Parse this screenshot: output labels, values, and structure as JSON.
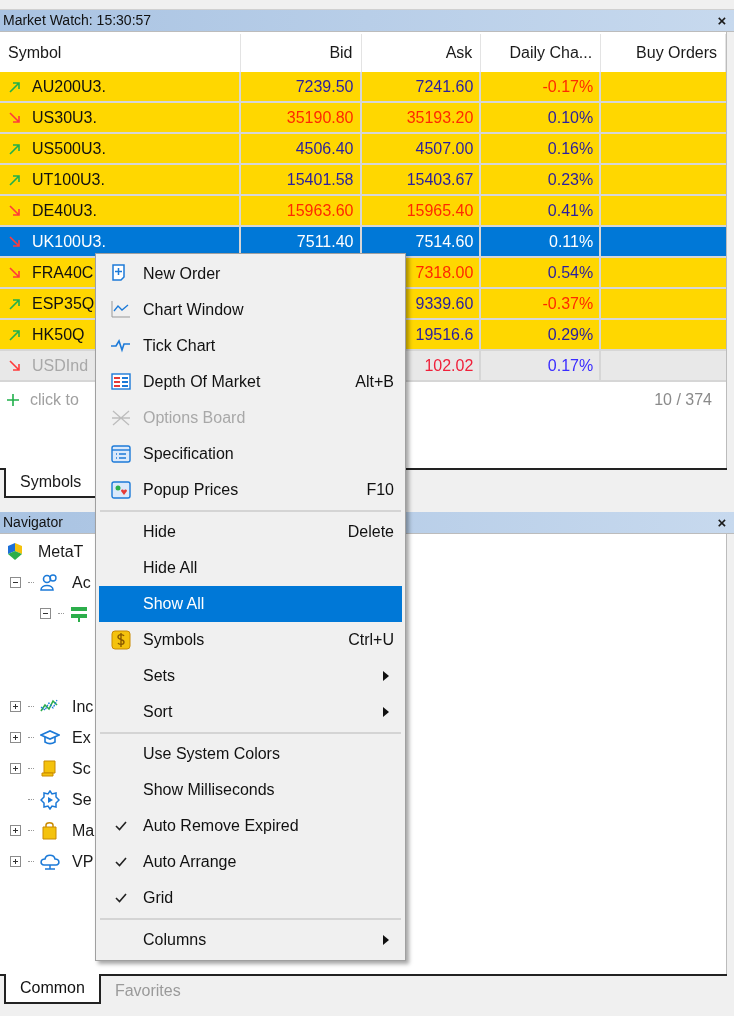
{
  "market_watch": {
    "title": "Market Watch: 15:30:57",
    "close": "×",
    "columns": [
      "Symbol",
      "Bid",
      "Ask",
      "Daily Cha...",
      "Buy Orders"
    ],
    "rows": [
      {
        "symbol": "AU200U3.",
        "trend_up": true,
        "bid": "7239.50",
        "bid_up": true,
        "ask": "7241.60",
        "ask_up": true,
        "change": "-0.17%",
        "change_up": false,
        "selected": false,
        "disabled": false
      },
      {
        "symbol": "US30U3.",
        "trend_up": false,
        "bid": "35190.80",
        "bid_up": false,
        "ask": "35193.20",
        "ask_up": false,
        "change": "0.10%",
        "change_up": true,
        "selected": false,
        "disabled": false
      },
      {
        "symbol": "US500U3.",
        "trend_up": true,
        "bid": "4506.40",
        "bid_up": true,
        "ask": "4507.00",
        "ask_up": true,
        "change": "0.16%",
        "change_up": true,
        "selected": false,
        "disabled": false
      },
      {
        "symbol": "UT100U3.",
        "trend_up": true,
        "bid": "15401.58",
        "bid_up": true,
        "ask": "15403.67",
        "ask_up": true,
        "change": "0.23%",
        "change_up": true,
        "selected": false,
        "disabled": false
      },
      {
        "symbol": "DE40U3.",
        "trend_up": false,
        "bid": "15963.60",
        "bid_up": false,
        "ask": "15965.40",
        "ask_up": false,
        "change": "0.41%",
        "change_up": true,
        "selected": false,
        "disabled": false
      },
      {
        "symbol": "UK100U3.",
        "trend_up": false,
        "bid": "7511.40",
        "ask": "7514.60",
        "change": "0.11%",
        "selected": true,
        "disabled": false
      },
      {
        "symbol": "FRA40C",
        "trend_up": false,
        "ask": "7318.00",
        "ask_up": false,
        "change": "0.54%",
        "change_up": true,
        "selected": false,
        "disabled": false
      },
      {
        "symbol": "ESP35Q",
        "trend_up": true,
        "ask": "9339.60",
        "ask_up": true,
        "change": "-0.37%",
        "change_up": false,
        "selected": false,
        "disabled": false
      },
      {
        "symbol": "HK50Q",
        "trend_up": true,
        "ask": "19516.6",
        "ask_up": true,
        "change": "0.29%",
        "change_up": true,
        "selected": false,
        "disabled": false
      },
      {
        "symbol": "USDInd",
        "trend_up": false,
        "ask": "102.02",
        "ask_up": false,
        "change": "0.17%",
        "change_up": true,
        "selected": false,
        "disabled": true
      }
    ],
    "add_row": "click to",
    "count": "10 / 374",
    "tabs": [
      {
        "label": "Symbols",
        "selected": true
      }
    ]
  },
  "navigator": {
    "title": "Navigator",
    "close": "×",
    "tree": [
      {
        "label": "MetaT",
        "expandable": false,
        "children": [
          {
            "label": "Ac",
            "expandable": true,
            "expanded": true,
            "children": [
              {
                "expandable": true,
                "expanded": true
              }
            ]
          },
          {
            "label": "Inc",
            "expandable": true,
            "expanded": false
          },
          {
            "label": "Ex",
            "expandable": true,
            "expanded": false
          },
          {
            "label": "Sc",
            "expandable": true,
            "expanded": false
          },
          {
            "label": "Se",
            "expandable": false
          },
          {
            "label": "Ma",
            "expandable": true,
            "expanded": false
          },
          {
            "label": "VP",
            "expandable": true,
            "expanded": false
          }
        ]
      }
    ],
    "tabs": [
      {
        "label": "Common",
        "selected": true
      },
      {
        "label": "Favorites",
        "selected": false
      }
    ]
  },
  "context_menu": [
    {
      "kind": "item",
      "label": "New Order",
      "checked": false,
      "selected": false,
      "disabled": false,
      "submenu": false
    },
    {
      "kind": "item",
      "label": "Chart Window",
      "checked": false,
      "selected": false,
      "disabled": false,
      "submenu": false
    },
    {
      "kind": "item",
      "label": "Tick Chart",
      "checked": false,
      "selected": false,
      "disabled": false,
      "submenu": false
    },
    {
      "kind": "item",
      "label": "Depth Of Market",
      "shortcut": "Alt+B",
      "checked": false,
      "selected": false,
      "disabled": false,
      "submenu": false
    },
    {
      "kind": "item",
      "label": "Options Board",
      "checked": false,
      "selected": false,
      "disabled": true,
      "submenu": false
    },
    {
      "kind": "item",
      "label": "Specification",
      "checked": false,
      "selected": false,
      "disabled": false,
      "submenu": false
    },
    {
      "kind": "item",
      "label": "Popup Prices",
      "shortcut": "F10",
      "checked": false,
      "selected": false,
      "disabled": false,
      "submenu": false
    },
    {
      "kind": "separator"
    },
    {
      "kind": "item",
      "label": "Hide",
      "shortcut": "Delete",
      "checked": false,
      "selected": false,
      "disabled": false,
      "submenu": false
    },
    {
      "kind": "item",
      "label": "Hide All",
      "checked": false,
      "selected": false,
      "disabled": false,
      "submenu": false
    },
    {
      "kind": "item",
      "label": "Show All",
      "checked": false,
      "selected": true,
      "disabled": false,
      "submenu": false
    },
    {
      "kind": "item",
      "label": "Symbols",
      "shortcut": "Ctrl+U",
      "checked": false,
      "selected": false,
      "disabled": false,
      "submenu": false
    },
    {
      "kind": "item",
      "label": "Sets",
      "checked": false,
      "selected": false,
      "disabled": false,
      "submenu": true
    },
    {
      "kind": "item",
      "label": "Sort",
      "checked": false,
      "selected": false,
      "disabled": false,
      "submenu": true
    },
    {
      "kind": "separator"
    },
    {
      "kind": "item",
      "label": "Use System Colors",
      "checked": false,
      "selected": false,
      "disabled": false,
      "submenu": false
    },
    {
      "kind": "item",
      "label": "Show Milliseconds",
      "checked": false,
      "selected": false,
      "disabled": false,
      "submenu": false
    },
    {
      "kind": "item",
      "label": "Auto Remove Expired",
      "checked": true,
      "selected": false,
      "disabled": false,
      "submenu": false
    },
    {
      "kind": "item",
      "label": "Auto Arrange",
      "checked": true,
      "selected": false,
      "disabled": false,
      "submenu": false
    },
    {
      "kind": "item",
      "label": "Grid",
      "checked": true,
      "selected": false,
      "disabled": false,
      "submenu": false
    },
    {
      "kind": "separator"
    },
    {
      "kind": "item",
      "label": "Columns",
      "checked": false,
      "selected": false,
      "disabled": false,
      "submenu": true
    }
  ]
}
